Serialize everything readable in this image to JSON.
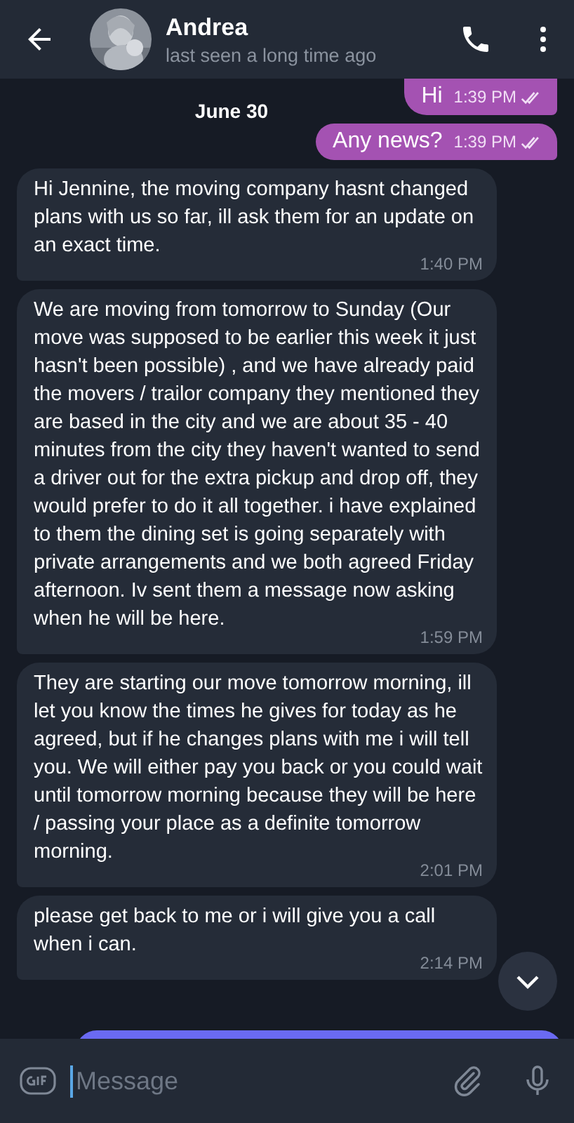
{
  "header": {
    "name": "Andrea",
    "status": "last seen a long time ago"
  },
  "date": "June 30",
  "messages": [
    {
      "outgoing": true,
      "read": true,
      "text": "Hi",
      "time": "1:39 PM"
    },
    {
      "outgoing": true,
      "read": true,
      "text": "Any news?",
      "time": "1:39 PM"
    },
    {
      "outgoing": false,
      "text": "Hi Jennine, the moving company hasnt changed plans with us so far, ill ask them for an update on an exact time.",
      "time": "1:40 PM"
    },
    {
      "outgoing": false,
      "text": "We are moving from tomorrow to Sunday (Our move was supposed to be earlier this week it just hasn't been possible) , and we have already paid the movers / trailor company they mentioned they are based in the city and we are about 35 - 40  minutes from the city they haven't wanted to send a driver out for the extra pickup and drop off, they would prefer to do it all together. i have explained to them the dining set is going separately with private arrangements and we both agreed Friday afternoon. Iv sent them a message now asking when he will be here.",
      "time": "1:59 PM"
    },
    {
      "outgoing": false,
      "text": "They are starting our move tomorrow morning, ill let you know the times he gives for today as he agreed, but if he changes plans with me i will tell you.  We will either pay you back or you could wait until tomorrow morning because they will be here / passing your place as a definite tomorrow morning.",
      "time": "2:01 PM"
    },
    {
      "outgoing": false,
      "text": "please get back to me or i will give you a call when i can.",
      "time": "2:14 PM"
    }
  ],
  "input": {
    "placeholder": "Message"
  }
}
